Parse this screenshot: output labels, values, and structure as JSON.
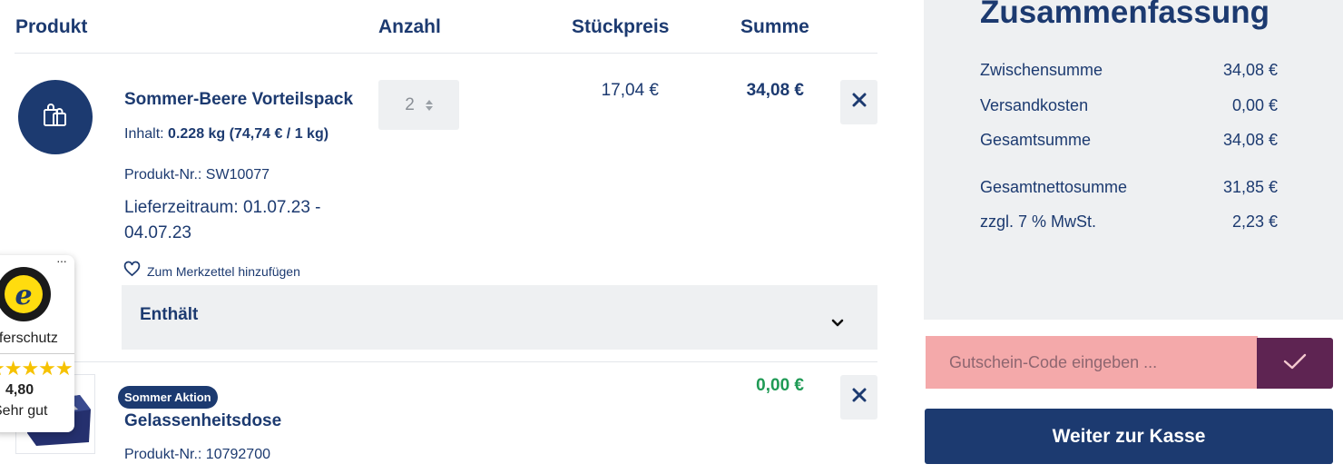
{
  "table_header": {
    "product": "Produkt",
    "quantity": "Anzahl",
    "unit_price": "Stückpreis",
    "total": "Summe"
  },
  "items": [
    {
      "name": "Sommer-Beere Vorteilspack",
      "content_label": "Inhalt:",
      "content_value": "0.228 kg (74,74 € / 1 kg)",
      "product_no": "Produkt-Nr.: SW10077",
      "delivery_line1": "Lieferzeitraum: 01.07.23 -",
      "delivery_line2": "04.07.23",
      "wishlist": "Zum Merkzettel hinzufügen",
      "quantity": "2",
      "unit_price": "17,04 €",
      "total": "34,08 €",
      "image_icon": "shopping-bags-icon",
      "contains_label": "Enthält"
    },
    {
      "badge": "Sommer Aktion",
      "name": "Gelassenheitsdose",
      "product_no": "Produkt-Nr.: 10792700",
      "total": "0,00 €",
      "total_color": "#1f9a55"
    }
  ],
  "trusted_shops": {
    "text": "uferschutz",
    "rating": "4,80",
    "rating_text": "Sehr gut",
    "stars": 5,
    "more": "···"
  },
  "summary": {
    "title": "Zusammenfassung",
    "rows": [
      {
        "label": "Zwischensumme",
        "value": "34,08 €"
      },
      {
        "label": "Versandkosten",
        "value": "0,00 €"
      },
      {
        "label": "Gesamtsumme",
        "value": "34,08 €"
      },
      {
        "label": "Gesamtnettosumme",
        "value": "31,85 €"
      },
      {
        "label": "zzgl. 7 % MwSt.",
        "value": "2,23 €"
      }
    ]
  },
  "coupon": {
    "placeholder": "Gutschein-Code eingeben ..."
  },
  "checkout": {
    "label": "Weiter zur Kasse"
  },
  "colors": {
    "primary": "#1c3a70",
    "panel": "#eef0f2",
    "coupon_bg": "#f4a9aa",
    "coupon_btn": "#5e2452",
    "free_price": "#1f9a55"
  }
}
